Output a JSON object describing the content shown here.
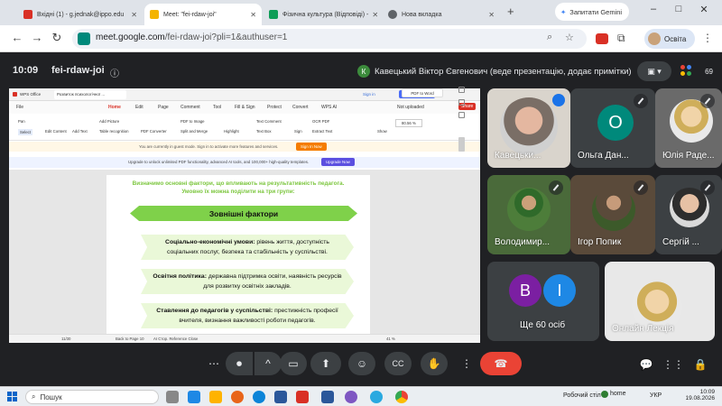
{
  "browser": {
    "tabs": [
      {
        "title": "Вхідні (1) - g.jednak@ippo.edu",
        "color": "#d93025"
      },
      {
        "title": "Meet: \"fei-rdaw-joi\"",
        "color": "#f4b400"
      },
      {
        "title": "Фізична культура (Відповіді) -",
        "color": "#0f9d58"
      },
      {
        "title": "Нова вкладка",
        "color": "#5f6368"
      }
    ],
    "new_tab": "+",
    "gemini_label": "Запитати Gemini",
    "url_host": "meet.google.com",
    "url_path": "/fei-rdaw-joi?pli=1&authuser=1",
    "profile_label": "Освіта",
    "window_controls": [
      "–",
      "□",
      "✕"
    ]
  },
  "meet": {
    "time": "10:09",
    "code": "fei-rdaw-joi",
    "presenter_initial": "К",
    "presenter_text": "Кавецький Віктор Євгенович (веде презентацію, додає примітки)",
    "participant_count": "69",
    "people_colors": [
      "#ea4335",
      "#4285f4",
      "#fbbc04",
      "#34a853"
    ]
  },
  "wps": {
    "app_tab": "WPS Office",
    "doc_tab": "Розвиток психологічної ...",
    "sign_in": "Sign in",
    "upgrade": "Upgrade Now",
    "menu": [
      "File",
      "Home",
      "Edit",
      "Page",
      "Comment",
      "Tool",
      "Fill & Sign",
      "Protect",
      "Convert",
      "WPS AI"
    ],
    "not_uploaded": "Not uploaded",
    "share": "Share",
    "ribbon": [
      "Pan",
      "Select",
      "Edit Content",
      "Add Text",
      "Add Picture",
      "Table recognition",
      "PDF Converter",
      "PDF to Image",
      "Split and Merge",
      "Highlight",
      "Text Comment",
      "Text Box",
      "Sign",
      "OCR PDF",
      "Extract Text",
      "Show",
      "80.56 %"
    ],
    "guest_notice": "You are currently in guest mode. Sign in to activate more features and services.",
    "guest_signin": "Sign In Now",
    "upgrade_notice": "Upgrade to unlock unlimited PDF functionality, advanced AI tools, and 100,000+ high-quality templates.",
    "upgrade_button": "Upgrade Now",
    "pdf_to_word": "PDF to Word",
    "status_page": "11/30",
    "status_back": "Back to Page 10",
    "status_ref": "AI Стор. Reference Close",
    "status_zoom": "41 %"
  },
  "slide": {
    "intro_line1": "Визначимо основні фактори, що впливають на результативність педагога.",
    "intro_line2": "Умовно їх можна поділити на три групи:",
    "banner": "Зовнішні фактори",
    "factors": [
      {
        "title": "Соціально-економічні умови:",
        "text": "рівень життя, доступність соціальних послуг, безпека та стабільність у суспільстві."
      },
      {
        "title": "Освітня політика:",
        "text": "державна підтримка освіти, наявність ресурсів для розвитку освітніх закладів."
      },
      {
        "title": "Ставлення до педагогів у суспільстві:",
        "text": "престижність професії вчителя, визнання важливості роботи педагогів."
      }
    ]
  },
  "participants": [
    {
      "name": "Кавецьки...",
      "kind": "photo"
    },
    {
      "name": "Ольга Дан...",
      "initial": "О",
      "color": "#00897b"
    },
    {
      "name": "Юлія Раде...",
      "kind": "photo"
    },
    {
      "name": "Володимир...",
      "kind": "photo"
    },
    {
      "name": "Ігор Попик",
      "kind": "photo"
    },
    {
      "name": "Сергій ...",
      "kind": "photo"
    },
    {
      "name": "Ще 60 осіб",
      "initials": [
        "В",
        "І"
      ],
      "colors": [
        "#7b1fa2",
        "#1e88e5"
      ]
    },
    {
      "name": "Онлайн Лекція",
      "kind": "photo"
    }
  ],
  "controls": {
    "more": "⋯",
    "mic": "🎤",
    "chevron": "^",
    "camera": "▭",
    "present": "⬆",
    "emoji": "☺",
    "cc": "CC",
    "hand": "✋",
    "options": "⋮",
    "hangup": "☎",
    "chat": "💬",
    "activities": "⋮⋮",
    "lock": "🔒"
  },
  "taskbar": {
    "search": "Пошук",
    "desk": "Робочий стіл",
    "home": "home",
    "lang": "УКР",
    "time": "10:09",
    "date": "19.08.2026"
  }
}
